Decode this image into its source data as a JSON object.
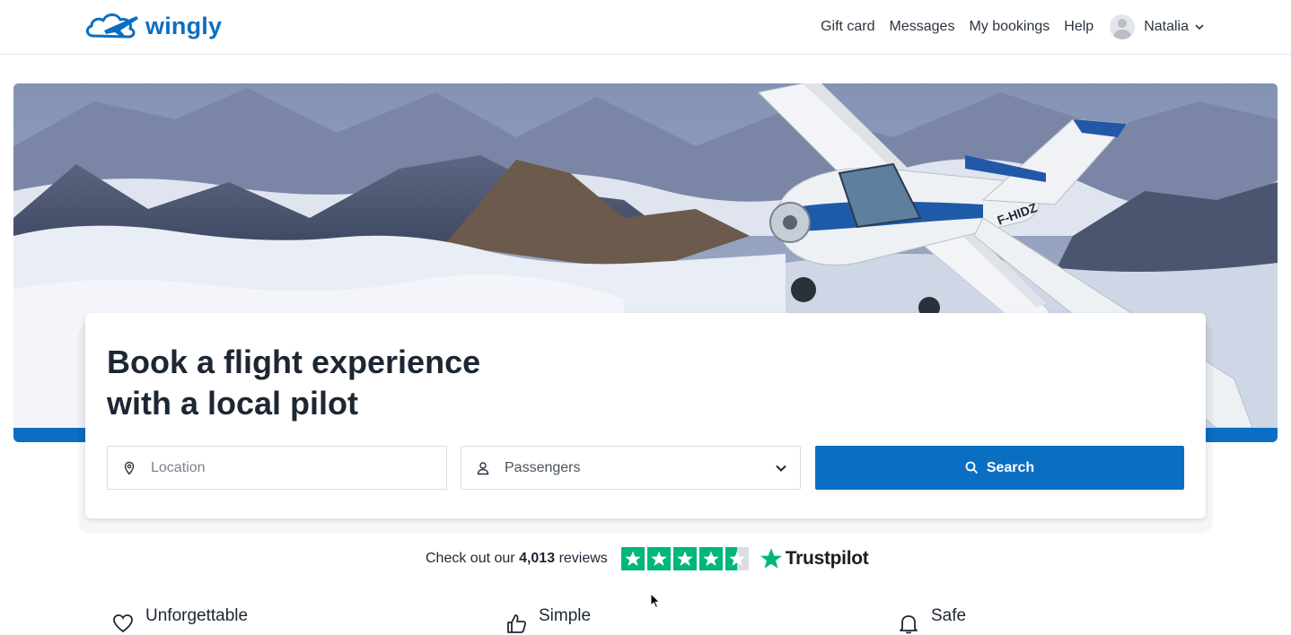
{
  "header": {
    "brand": "wingly",
    "nav": [
      "Gift card",
      "Messages",
      "My bookings",
      "Help"
    ],
    "user_name": "Natalia"
  },
  "hero": {
    "title_line1": "Book a flight experience",
    "title_line2": "with a local pilot",
    "plane_registration": "F-HIDZ"
  },
  "search": {
    "location_placeholder": "Location",
    "passengers_label": "Passengers",
    "search_button": "Search"
  },
  "reviews": {
    "prefix": "Check out our",
    "count": "4,013",
    "suffix": "reviews",
    "rating_stars": 4.5,
    "brand": "Trustpilot"
  },
  "features": [
    "Unforgettable",
    "Simple",
    "Safe"
  ],
  "colors": {
    "brand_blue": "#0a6fc2",
    "trustpilot_green": "#00b67a"
  }
}
